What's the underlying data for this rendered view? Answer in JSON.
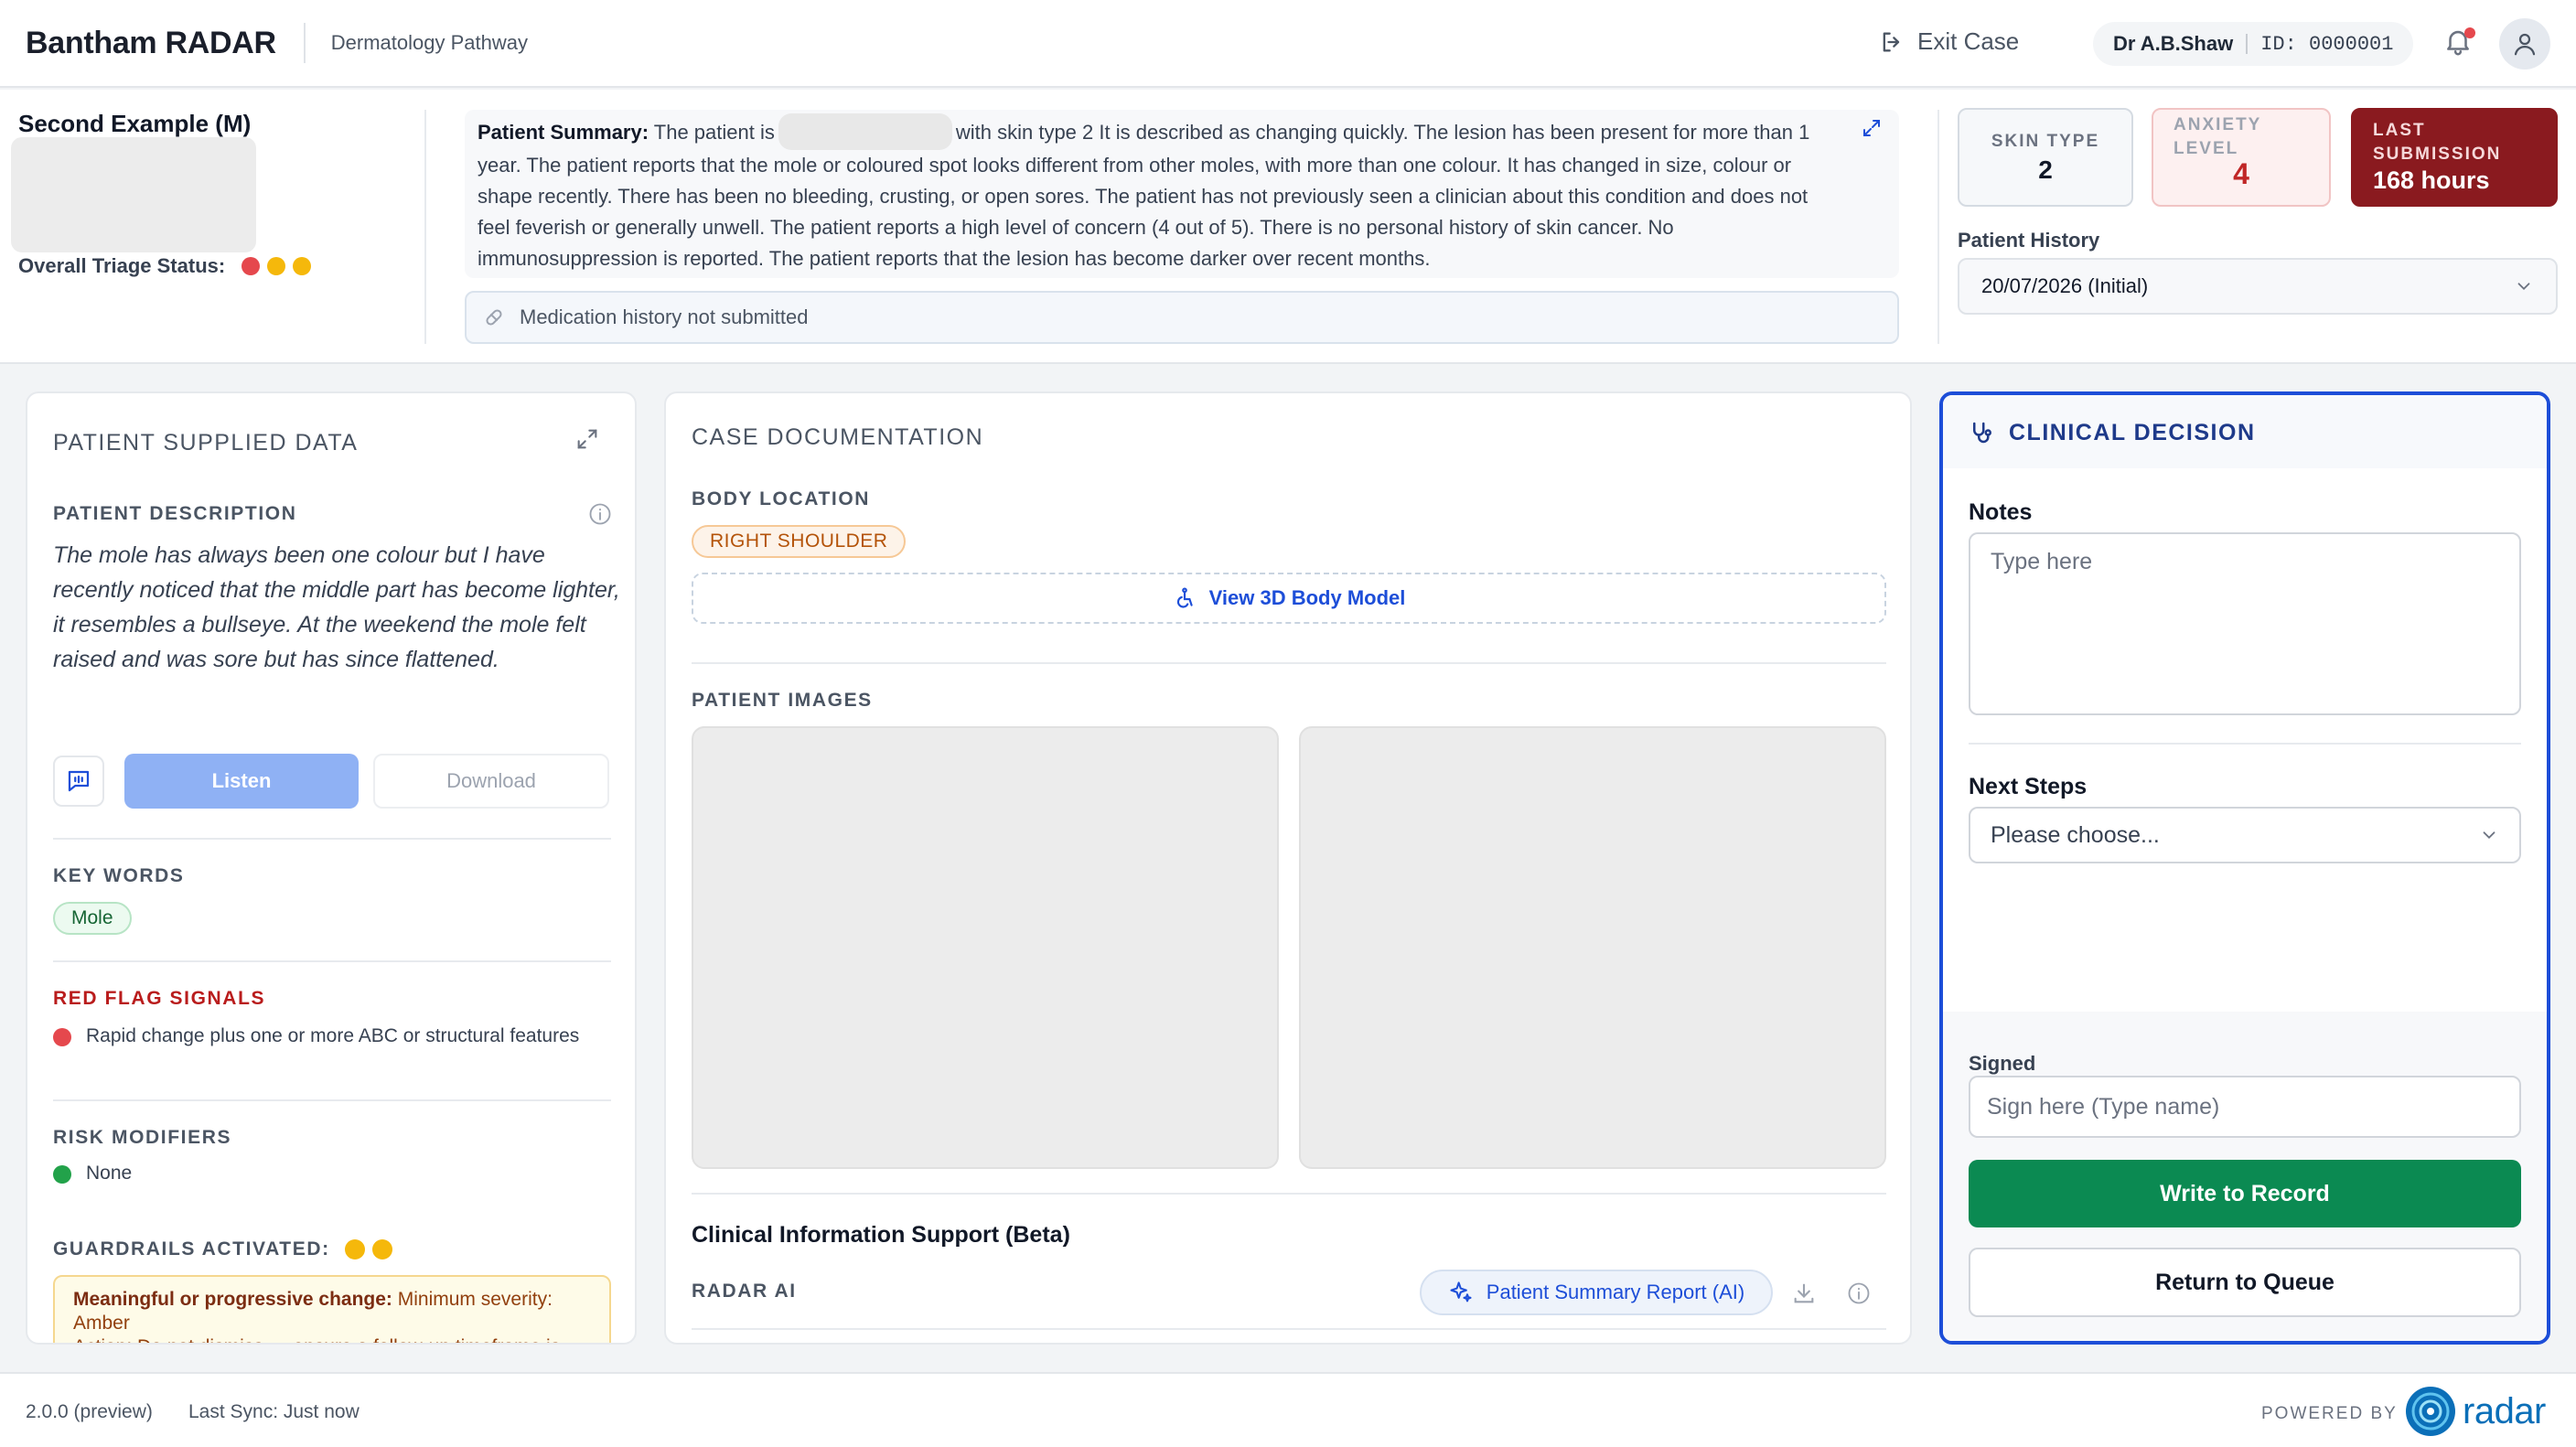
{
  "header": {
    "brand": "Bantham RADAR",
    "pathway": "Dermatology Pathway",
    "exit_label": "Exit Case",
    "user_name": "Dr A.B.Shaw",
    "user_id": "ID: 0000001"
  },
  "patient": {
    "name": "Second Example (M)",
    "triage_label": "Overall Triage Status:",
    "triage_dots": [
      "#e5484d",
      "#f5b80b",
      "#f5b80b"
    ]
  },
  "summary": {
    "label": "Patient Summary:",
    "lead": "The patient is",
    "text": "with skin type 2 It is described as changing quickly. The lesion has been present for more than 1 year. The patient reports that the mole or coloured spot looks different from other moles, with more than one colour. It has changed in size, colour or shape recently. There has been no bleeding, crusting, or open sores. The patient has not previously seen a clinician about this condition and does not feel feverish or generally unwell. The patient reports a high level of concern (4 out of 5). There is no personal history of skin cancer. No immunosuppression is reported. The patient reports that the lesion has become darker over recent months.",
    "medication": "Medication history not submitted"
  },
  "stats": {
    "skin_type_label": "SKIN TYPE",
    "skin_type_value": "2",
    "anxiety_label_1": "ANXIETY",
    "anxiety_label_2": "LEVEL",
    "anxiety_value": "4",
    "last_label_1": "LAST",
    "last_label_2": "SUBMISSION",
    "last_value": "168 hours"
  },
  "history": {
    "label": "Patient History",
    "selected": "20/07/2026 (Initial)"
  },
  "supplied": {
    "title": "PATIENT SUPPLIED DATA",
    "description_label": "PATIENT DESCRIPTION",
    "description": "The mole has always been one colour but I have recently noticed that the middle part has become lighter, it resembles a bullseye. At the weekend the mole felt raised and was sore but has since flattened.",
    "listen_label": "Listen",
    "download_label": "Download",
    "keywords_label": "KEY WORDS",
    "keywords": [
      "Mole"
    ],
    "red_flags_label": "RED FLAG SIGNALS",
    "red_flags": [
      "Rapid change plus one or more ABC or structural features"
    ],
    "risk_label": "RISK MODIFIERS",
    "risk_items": [
      "None"
    ],
    "guardrails_label": "GUARDRAILS ACTIVATED:",
    "guardrail_title": "Meaningful or progressive change:",
    "guardrail_text": "Minimum severity: Amber",
    "guardrail_more": "Action: Do not dismiss — ensure a follow-up timeframe is set"
  },
  "documentation": {
    "title": "CASE DOCUMENTATION",
    "body_location_label": "BODY LOCATION",
    "body_location": "RIGHT SHOULDER",
    "body_model_label": "View 3D Body Model",
    "images_label": "PATIENT IMAGES",
    "cis_title": "Clinical Information Support (Beta)",
    "radar_ai_label": "RADAR AI",
    "report_label": "Patient Summary Report (AI)"
  },
  "decision": {
    "title": "CLINICAL DECISION",
    "notes_label": "Notes",
    "notes_placeholder": "Type here",
    "next_steps_label": "Next Steps",
    "next_steps_value": "Please choose...",
    "signed_label": "Signed",
    "sign_placeholder": "Sign here (Type name)",
    "write_label": "Write to Record",
    "return_label": "Return to Queue"
  },
  "footer": {
    "version": "2.0.0 (preview)",
    "sync": "Last Sync: Just now",
    "powered_by": "POWERED BY",
    "logo_text": "radar"
  },
  "colors": {
    "primary_blue": "#1d4ed8",
    "danger_red": "#e5484d",
    "amber": "#f5b80b",
    "green": "#22a24a",
    "write_green": "#0b8a52",
    "last_submission_bg": "#8a1a1f"
  }
}
